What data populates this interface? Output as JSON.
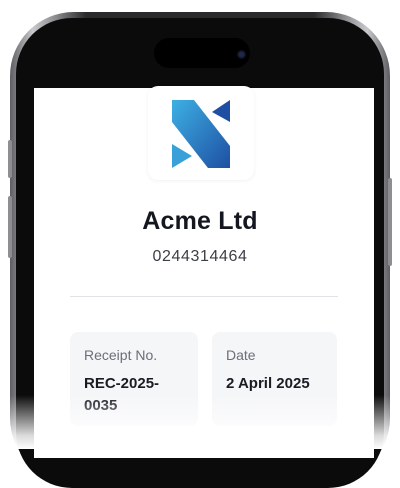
{
  "company": {
    "name": "Acme Ltd",
    "phone": "0244314464"
  },
  "receipt": {
    "label": "Receipt No.",
    "value": "REC-2025-0035"
  },
  "date": {
    "label": "Date",
    "value": "2 April 2025"
  },
  "colors": {
    "logo_dark": "#1f4a9e",
    "logo_light": "#3aa0d8",
    "text": "#141620"
  },
  "icons": {
    "logo": "company-logo-icon"
  }
}
